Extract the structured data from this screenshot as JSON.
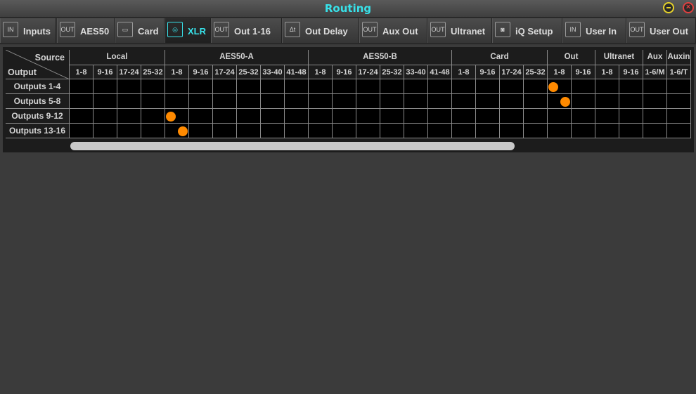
{
  "window": {
    "title": "Routing"
  },
  "tabs": [
    {
      "label": "Inputs",
      "icon": "in-icon",
      "icon_text": "IN",
      "active": false
    },
    {
      "label": "AES50",
      "icon": "out-icon",
      "icon_text": "OUT",
      "active": false
    },
    {
      "label": "Card",
      "icon": "card-icon",
      "icon_text": "▭",
      "active": false
    },
    {
      "label": "XLR",
      "icon": "xlr-icon",
      "icon_text": "◎",
      "active": true
    },
    {
      "label": "Out 1-16",
      "icon": "out-icon",
      "icon_text": "OUT",
      "active": false
    },
    {
      "label": "Out Delay",
      "icon": "delta-t-icon",
      "icon_text": "Δt",
      "active": false
    },
    {
      "label": "Aux Out",
      "icon": "out-icon",
      "icon_text": "OUT",
      "active": false
    },
    {
      "label": "Ultranet",
      "icon": "out-icon",
      "icon_text": "OUT",
      "active": false
    },
    {
      "label": "iQ Setup",
      "icon": "speaker-icon",
      "icon_text": "◙",
      "active": false
    },
    {
      "label": "User In",
      "icon": "in-icon",
      "icon_text": "IN",
      "active": false
    },
    {
      "label": "User Out",
      "icon": "out-icon",
      "icon_text": "OUT",
      "active": false
    }
  ],
  "matrix": {
    "corner_source": "Source",
    "corner_output": "Output",
    "groups": [
      {
        "name": "Local",
        "cols": [
          "1-8",
          "9-16",
          "17-24",
          "25-32"
        ]
      },
      {
        "name": "AES50-A",
        "cols": [
          "1-8",
          "9-16",
          "17-24",
          "25-32",
          "33-40",
          "41-48"
        ]
      },
      {
        "name": "AES50-B",
        "cols": [
          "1-8",
          "9-16",
          "17-24",
          "25-32",
          "33-40",
          "41-48"
        ]
      },
      {
        "name": "Card",
        "cols": [
          "1-8",
          "9-16",
          "17-24",
          "25-32"
        ]
      },
      {
        "name": "Out",
        "cols": [
          "1-8",
          "9-16"
        ]
      },
      {
        "name": "Ultranet",
        "cols": [
          "1-8",
          "9-16"
        ]
      },
      {
        "name": "Aux",
        "cols": [
          "1-6/M"
        ]
      },
      {
        "name": "Auxin",
        "cols": [
          "1-6/T"
        ]
      }
    ],
    "rows": [
      "Outputs 1-4",
      "Outputs 5-8",
      "Outputs 9-12",
      "Outputs 13-16"
    ],
    "assignments": [
      {
        "row": 0,
        "sub_column": 40
      },
      {
        "row": 1,
        "sub_column": 41
      },
      {
        "row": 2,
        "sub_column": 8
      },
      {
        "row": 3,
        "sub_column": 9
      }
    ]
  },
  "colors": {
    "accent": "#38e2ea",
    "dot": "#ff8a00",
    "grid_line": "#8a8a8a",
    "cell_bg": "#000000",
    "header_bg": "#1c1c1c"
  }
}
